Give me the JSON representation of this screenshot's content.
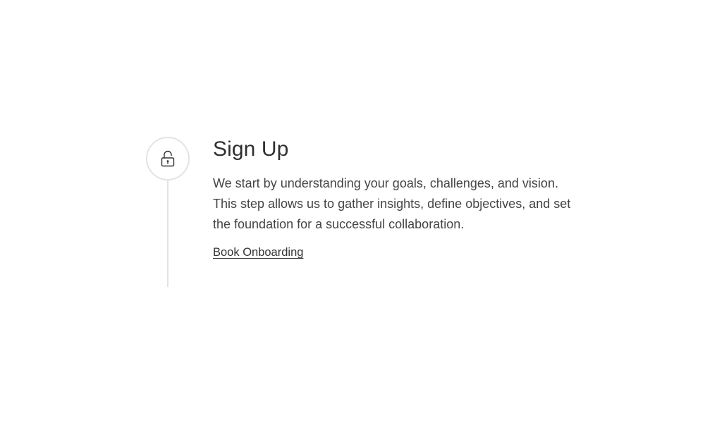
{
  "step": {
    "icon": "unlock-icon",
    "title": "Sign Up",
    "description": "We start by understanding your goals, challenges, and vision. This step allows us to gather insights, define objectives, and set the foundation for a successful collaboration.",
    "link_label": "Book Onboarding"
  },
  "colors": {
    "text": "#333333",
    "marker_border": "#e3e3e3",
    "background": "#ffffff"
  }
}
